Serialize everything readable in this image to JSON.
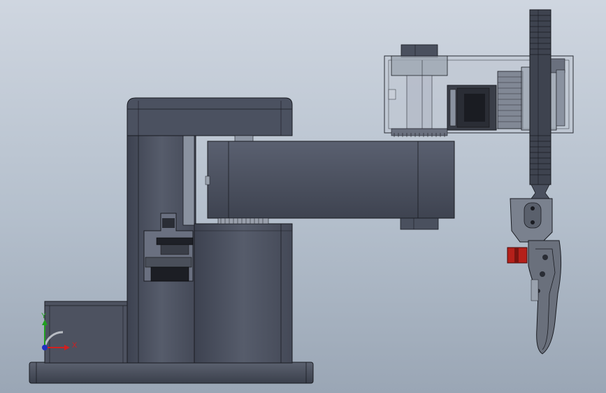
{
  "viewport": {
    "background_top": "#cfd6e0",
    "background_bottom": "#9aa6b5"
  },
  "model": {
    "body_color": "#4a5060",
    "body_dark": "#343844",
    "edge_color": "#1a1c22",
    "transparent_housing": "#c0c7d2",
    "servo_red": "#b5201a"
  },
  "triad": {
    "x_label": "X",
    "y_label": "Y",
    "x_color": "#d02020",
    "y_color": "#20a020",
    "z_color": "#2030c0"
  }
}
